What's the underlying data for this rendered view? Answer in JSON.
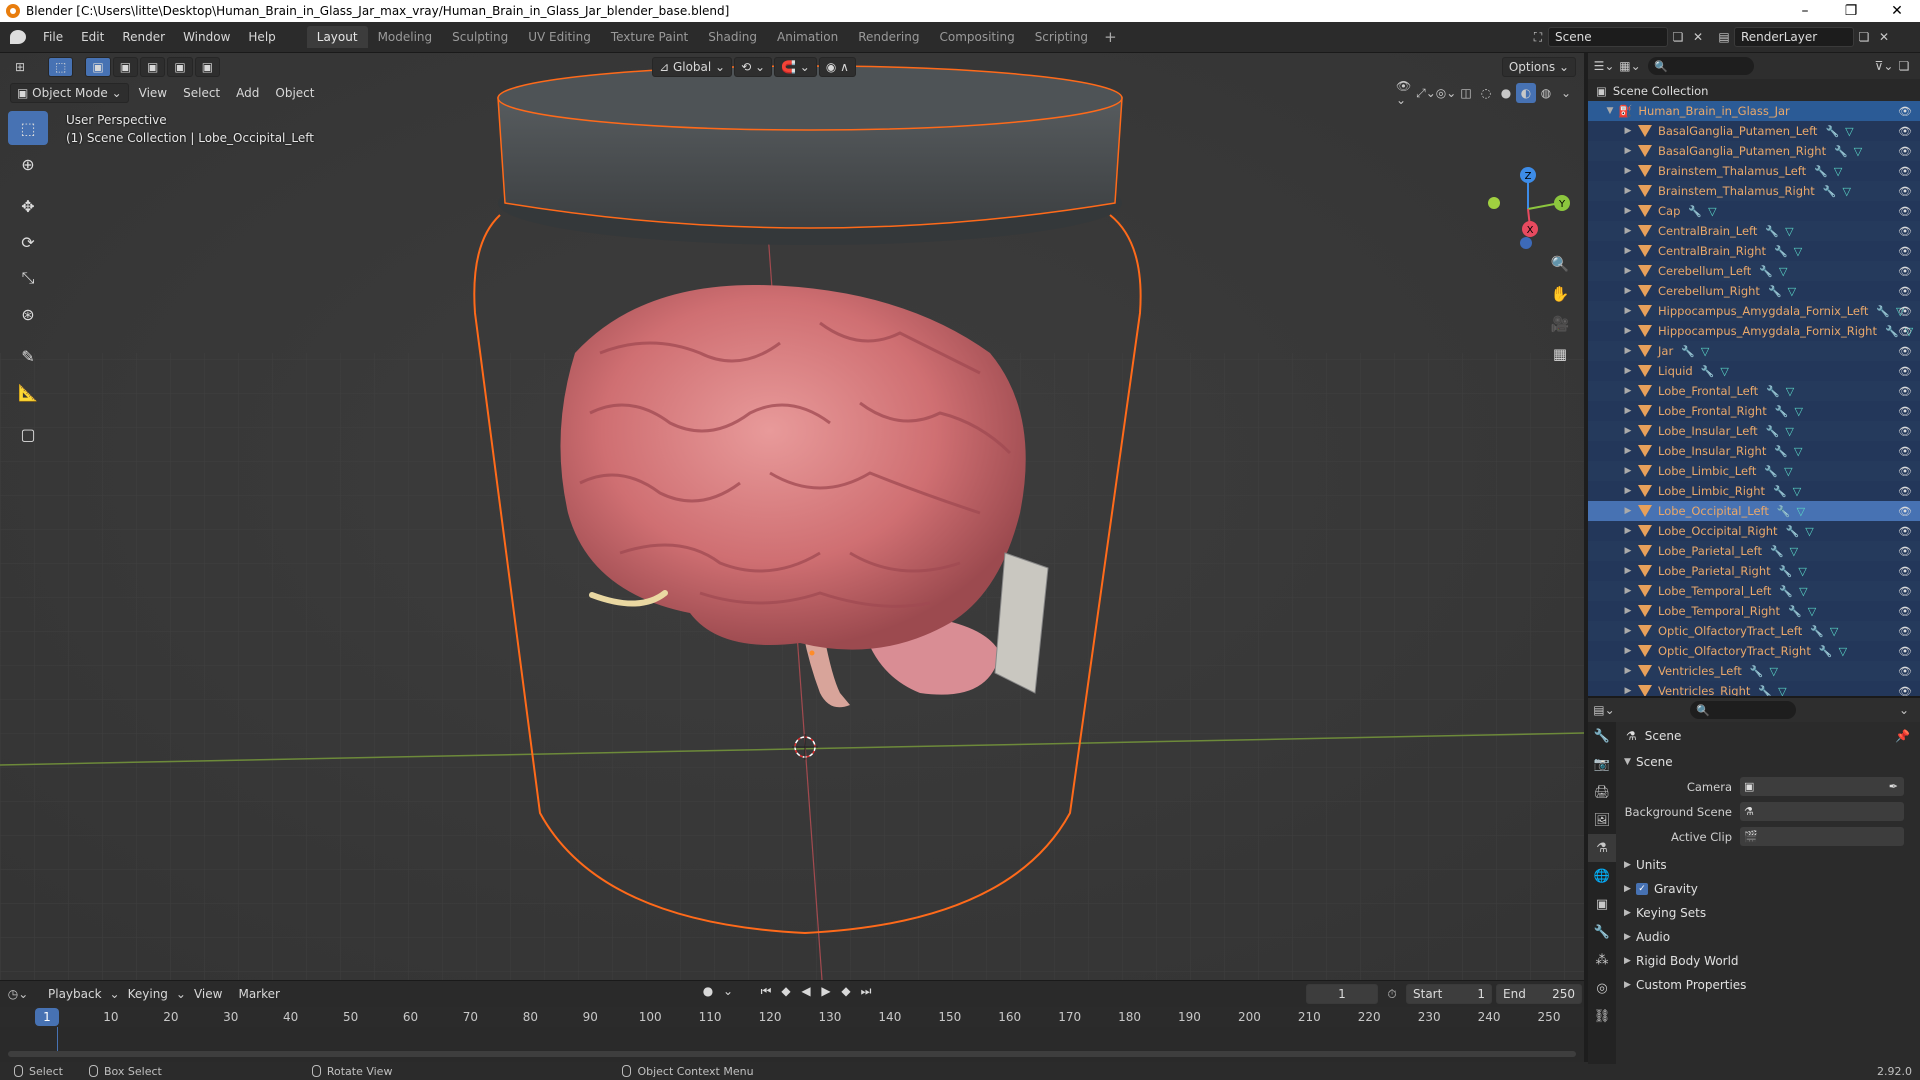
{
  "window": {
    "title": "Blender [C:\\Users\\litte\\Desktop\\Human_Brain_in_Glass_Jar_max_vray/Human_Brain_in_Glass_Jar_blender_base.blend]"
  },
  "menubar": {
    "menus": [
      "File",
      "Edit",
      "Render",
      "Window",
      "Help"
    ],
    "workspaces": [
      "Layout",
      "Modeling",
      "Sculpting",
      "UV Editing",
      "Texture Paint",
      "Shading",
      "Animation",
      "Rendering",
      "Compositing",
      "Scripting"
    ],
    "active_workspace": "Layout",
    "scene_name": "Scene",
    "view_layer": "RenderLayer"
  },
  "viewport": {
    "mode": "Object Mode",
    "menus": [
      "View",
      "Select",
      "Add",
      "Object"
    ],
    "transform_orientation": "Global",
    "options_label": "Options",
    "info_line1": "User Perspective",
    "info_line2": "(1) Scene Collection | Lobe_Occipital_Left",
    "axes": {
      "x": "X",
      "y": "Y",
      "z": "Z"
    }
  },
  "timeline": {
    "menus": [
      "Playback",
      "Keying",
      "View",
      "Marker"
    ],
    "current_frame": "1",
    "start_label": "Start",
    "start": "1",
    "end_label": "End",
    "end": "250",
    "ruler": [
      "1",
      "10",
      "20",
      "30",
      "40",
      "50",
      "60",
      "70",
      "80",
      "90",
      "100",
      "110",
      "120",
      "130",
      "140",
      "150",
      "160",
      "170",
      "180",
      "190",
      "200",
      "210",
      "220",
      "230",
      "240",
      "250"
    ]
  },
  "statusbar": {
    "select": "Select",
    "box_select": "Box Select",
    "rotate_view": "Rotate View",
    "context_menu": "Object Context Menu",
    "version": "2.92.0"
  },
  "outliner": {
    "root": "Scene Collection",
    "collection": "Human_Brain_in_Glass_Jar",
    "active_item": "Lobe_Occipital_Left",
    "items": [
      "BasalGanglia_Putamen_Left",
      "BasalGanglia_Putamen_Right",
      "Brainstem_Thalamus_Left",
      "Brainstem_Thalamus_Right",
      "Cap",
      "CentralBrain_Left",
      "CentralBrain_Right",
      "Cerebellum_Left",
      "Cerebellum_Right",
      "Hippocampus_Amygdala_Fornix_Left",
      "Hippocampus_Amygdala_Fornix_Right",
      "Jar",
      "Liquid",
      "Lobe_Frontal_Left",
      "Lobe_Frontal_Right",
      "Lobe_Insular_Left",
      "Lobe_Insular_Right",
      "Lobe_Limbic_Left",
      "Lobe_Limbic_Right",
      "Lobe_Occipital_Left",
      "Lobe_Occipital_Right",
      "Lobe_Parietal_Left",
      "Lobe_Parietal_Right",
      "Lobe_Temporal_Left",
      "Lobe_Temporal_Right",
      "Optic_OlfactoryTract_Left",
      "Optic_OlfactoryTract_Right",
      "Ventricles_Left",
      "Ventricles_Right"
    ]
  },
  "properties": {
    "breadcrumb": "Scene",
    "panel_scene": "Scene",
    "camera_label": "Camera",
    "background_scene_label": "Background Scene",
    "active_clip_label": "Active Clip",
    "panels": [
      "Units",
      "Gravity",
      "Keying Sets",
      "Audio",
      "Rigid Body World",
      "Custom Properties"
    ],
    "gravity_checked": true
  },
  "colors": {
    "selection_outline": "#ff6a1a",
    "active_blue": "#4772b3",
    "axis_x": "#e84a5f",
    "axis_y": "#8cc63e",
    "axis_z": "#3d8ce8"
  }
}
